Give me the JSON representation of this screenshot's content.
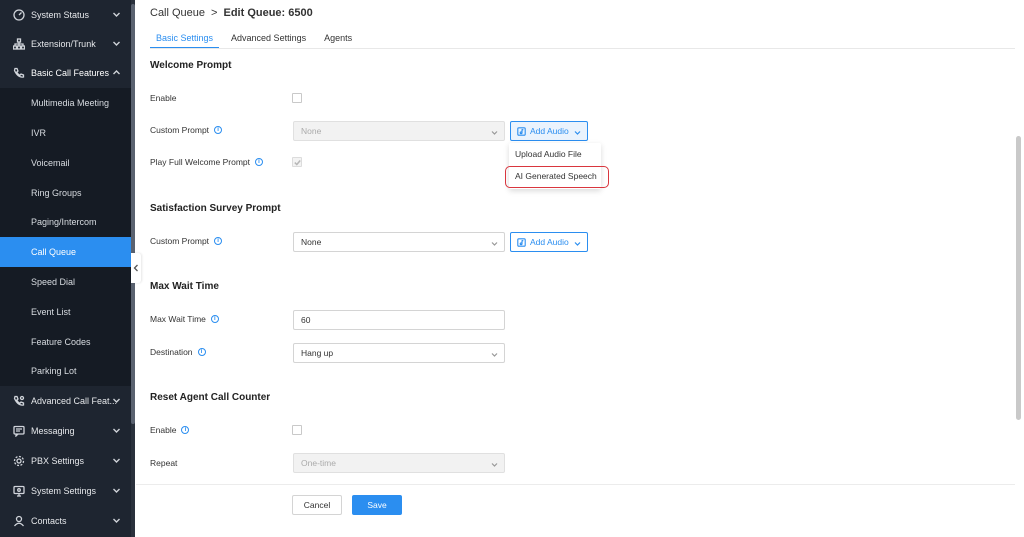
{
  "sidebar": {
    "items": [
      {
        "label": "System Status",
        "icon": "gauge-icon"
      },
      {
        "label": "Extension/Trunk",
        "icon": "sitemap-icon"
      },
      {
        "label": "Basic Call Features",
        "icon": "phone-icon"
      },
      {
        "label": "Advanced Call Feat...",
        "icon": "phone-settings-icon"
      },
      {
        "label": "Messaging",
        "icon": "message-icon"
      },
      {
        "label": "PBX Settings",
        "icon": "gear-icon"
      },
      {
        "label": "System Settings",
        "icon": "system-settings-icon"
      },
      {
        "label": "Contacts",
        "icon": "contact-icon"
      }
    ],
    "subitems": [
      "Multimedia Meeting",
      "IVR",
      "Voicemail",
      "Ring Groups",
      "Paging/Intercom",
      "Call Queue",
      "Speed Dial",
      "Event List",
      "Feature Codes",
      "Parking Lot"
    ],
    "active_subitem": "Call Queue"
  },
  "breadcrumb": {
    "parent": "Call Queue",
    "separator": ">",
    "current": "Edit Queue: 6500"
  },
  "tabs": [
    "Basic Settings",
    "Advanced Settings",
    "Agents"
  ],
  "active_tab": "Basic Settings",
  "welcome": {
    "title": "Welcome Prompt",
    "enable_label": "Enable",
    "enable_checked": false,
    "custom_prompt_label": "Custom Prompt",
    "custom_prompt_value": "None",
    "add_audio_label": "Add Audio",
    "play_full_label": "Play Full Welcome Prompt",
    "play_full_checked": true
  },
  "add_audio_menu": [
    "Upload Audio File",
    "AI Generated Speech"
  ],
  "survey": {
    "title": "Satisfaction Survey Prompt",
    "custom_prompt_label": "Custom Prompt",
    "custom_prompt_value": "None",
    "add_audio_label": "Add Audio"
  },
  "max_wait": {
    "title": "Max Wait Time",
    "max_wait_label": "Max Wait Time",
    "max_wait_value": "60",
    "destination_label": "Destination",
    "destination_value": "Hang up"
  },
  "reset_counter": {
    "title": "Reset Agent Call Counter",
    "enable_label": "Enable",
    "enable_checked": false,
    "repeat_label": "Repeat",
    "repeat_value": "One-time"
  },
  "footer": {
    "cancel_label": "Cancel",
    "save_label": "Save"
  },
  "colors": {
    "accent": "#2b8ef0",
    "sidebar_bg": "#1e2530",
    "highlight_border": "#d9363e"
  }
}
